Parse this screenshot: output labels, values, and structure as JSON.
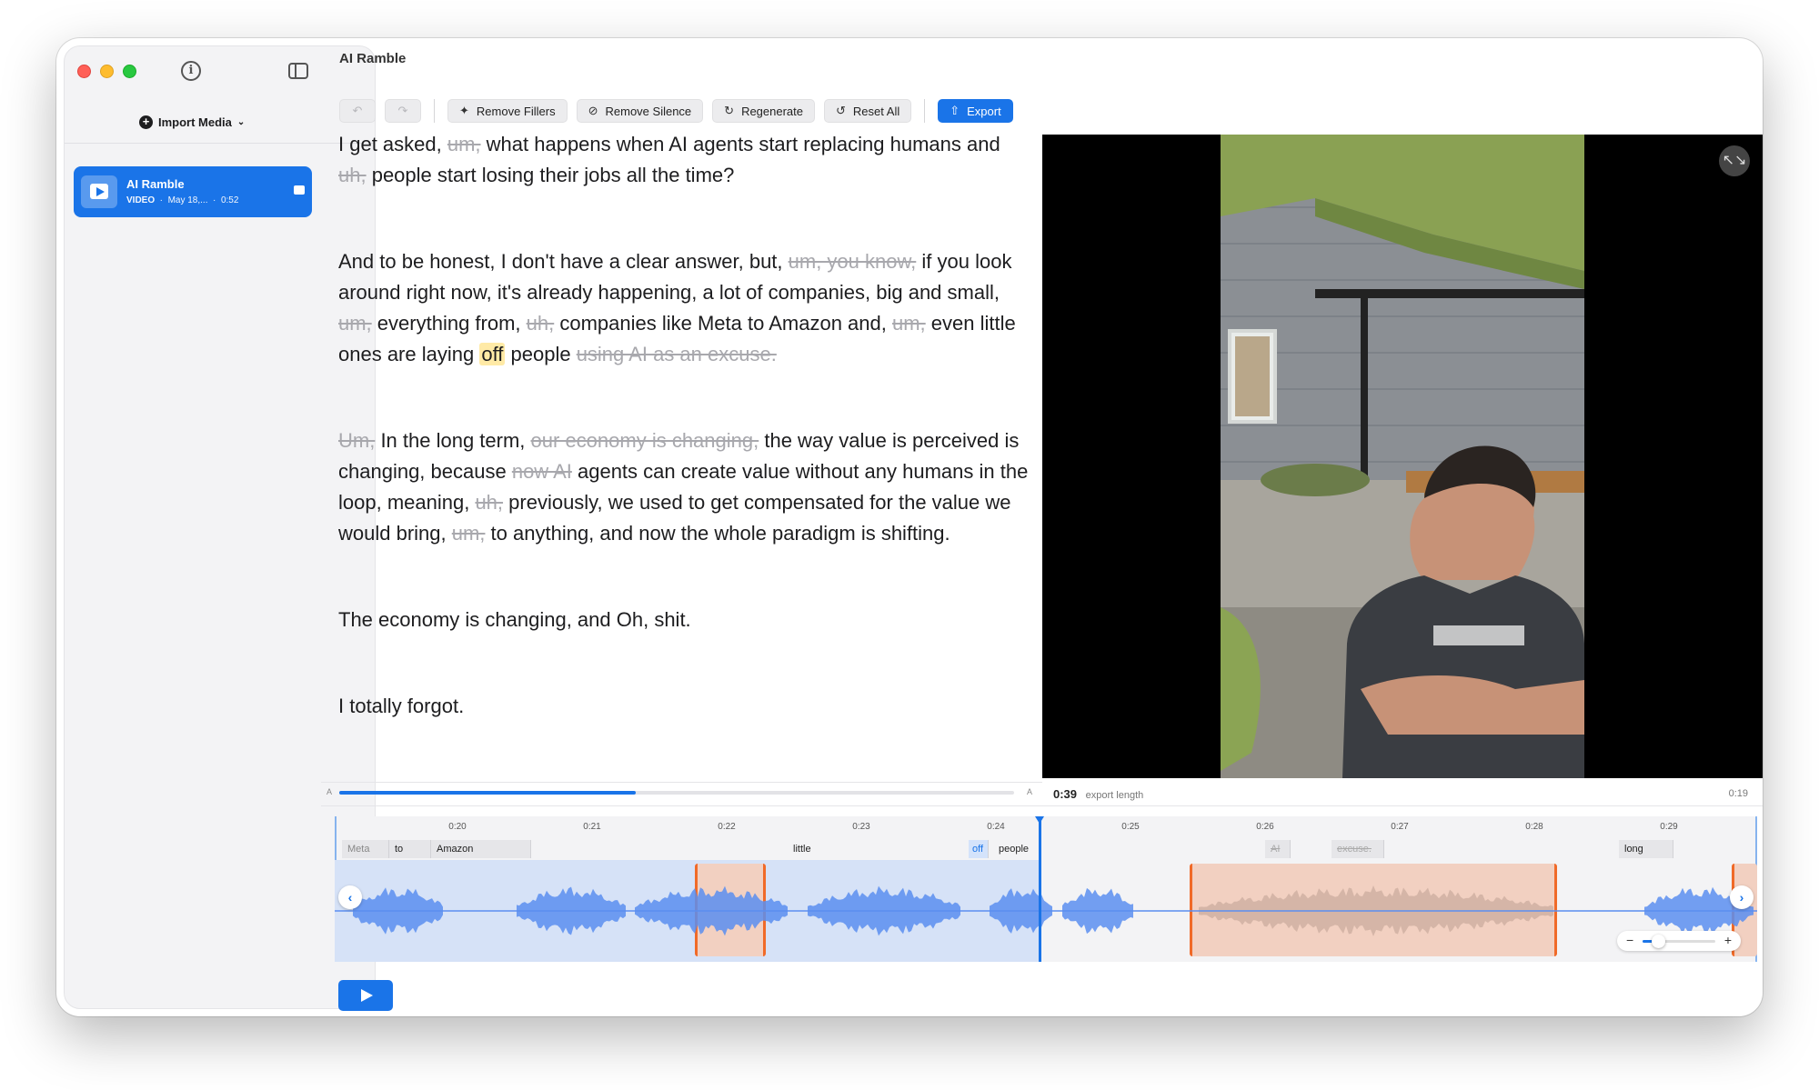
{
  "app": {
    "title": "AI Ramble"
  },
  "sidebar": {
    "import_label": "Import Media",
    "item": {
      "title": "AI Ramble",
      "type": "VIDEO",
      "date": "May 18,...",
      "duration": "0:52"
    }
  },
  "toolbar": {
    "remove_fillers": "Remove Fillers",
    "remove_silence": "Remove Silence",
    "regenerate": "Regenerate",
    "reset_all": "Reset All",
    "export": "Export"
  },
  "transcript": {
    "p1": [
      {
        "t": "I get asked, "
      },
      {
        "t": "um,",
        "s": true
      },
      {
        "t": " what happens when AI agents start replacing humans and "
      },
      {
        "t": "uh,",
        "s": true
      },
      {
        "t": " people start losing their jobs all the time?"
      }
    ],
    "p2": [
      {
        "t": "And to be honest, I don't have a clear answer, but, "
      },
      {
        "t": "um, you know,",
        "s": true
      },
      {
        "t": " if you look around right now, it's already happening, a lot of companies, big and small, "
      },
      {
        "t": "um,",
        "s": true
      },
      {
        "t": " everything from, "
      },
      {
        "t": "uh,",
        "s": true
      },
      {
        "t": " companies like Meta to Amazon and, "
      },
      {
        "t": "um,",
        "s": true
      },
      {
        "t": " even little ones are laying "
      },
      {
        "t": "off",
        "h": true
      },
      {
        "t": " people "
      },
      {
        "t": "using AI as an excuse.",
        "s": true
      }
    ],
    "p3": [
      {
        "t": "Um,",
        "s": true
      },
      {
        "t": " In the long term, "
      },
      {
        "t": "our economy is changing,",
        "s": true
      },
      {
        "t": " the way value is perceived is changing, because "
      },
      {
        "t": "now AI",
        "s": true
      },
      {
        "t": " agents can create value without any humans in the loop, meaning, "
      },
      {
        "t": "uh,",
        "s": true
      },
      {
        "t": " previously, we used to get compensated for the value we would bring, "
      },
      {
        "t": "um,",
        "s": true
      },
      {
        "t": " to anything, and now the whole paradigm is shifting."
      }
    ],
    "p4": [
      {
        "t": "The economy is changing, and Oh, shit."
      }
    ],
    "p5": [
      {
        "t": "I totally forgot."
      }
    ]
  },
  "player": {
    "export_length_value": "0:39",
    "export_length_label": "export length",
    "total": "0:19",
    "scrub_left": "A",
    "scrub_right": "A",
    "progress": 0.44
  },
  "timeline": {
    "ticks": [
      "0:20",
      "0:21",
      "0:22",
      "0:23",
      "0:24",
      "0:25",
      "0:26",
      "0:27",
      "0:28",
      "0:29"
    ],
    "words": {
      "w0": "Meta",
      "w1": "to",
      "w2": "Amazon",
      "w3": "little",
      "w4": "off",
      "w5": "people",
      "w6": "AI",
      "w7": "excuse.",
      "w8": "long"
    }
  },
  "colors": {
    "accent": "#1a74e8",
    "cut": "#f06a28",
    "cut_fill": "#f2d0c1",
    "played_fill": "#d6e2f7",
    "highlight": "#ffeaa6"
  }
}
